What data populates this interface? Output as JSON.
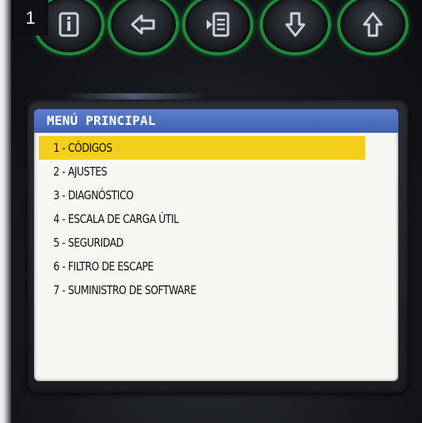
{
  "badge": {
    "number": "1"
  },
  "buttons": [
    {
      "name": "info-button",
      "icon": "info-icon"
    },
    {
      "name": "back-button",
      "icon": "arrow-left-icon"
    },
    {
      "name": "enter-button",
      "icon": "enter-icon"
    },
    {
      "name": "down-button",
      "icon": "arrow-down-icon"
    },
    {
      "name": "up-button",
      "icon": "arrow-up-icon"
    }
  ],
  "screen": {
    "title": "MENÚ PRINCIPAL",
    "items": [
      {
        "label": "1 - CÓDIGOS",
        "selected": true
      },
      {
        "label": "2 - AJUSTES",
        "selected": false
      },
      {
        "label": "3 - DIAGNÓSTICO",
        "selected": false
      },
      {
        "label": "4 - ESCALA DE CARGA ÚTIL",
        "selected": false
      },
      {
        "label": "5 - SEGURIDAD",
        "selected": false
      },
      {
        "label": "6 - FILTRO DE ESCAPE",
        "selected": false
      },
      {
        "label": "7 - SUMINISTRO DE SOFTWARE",
        "selected": false
      }
    ]
  },
  "colors": {
    "highlight": "#f3cf1a",
    "title_bar": "#4a6cbf",
    "button_glow": "#1f8a3a"
  }
}
